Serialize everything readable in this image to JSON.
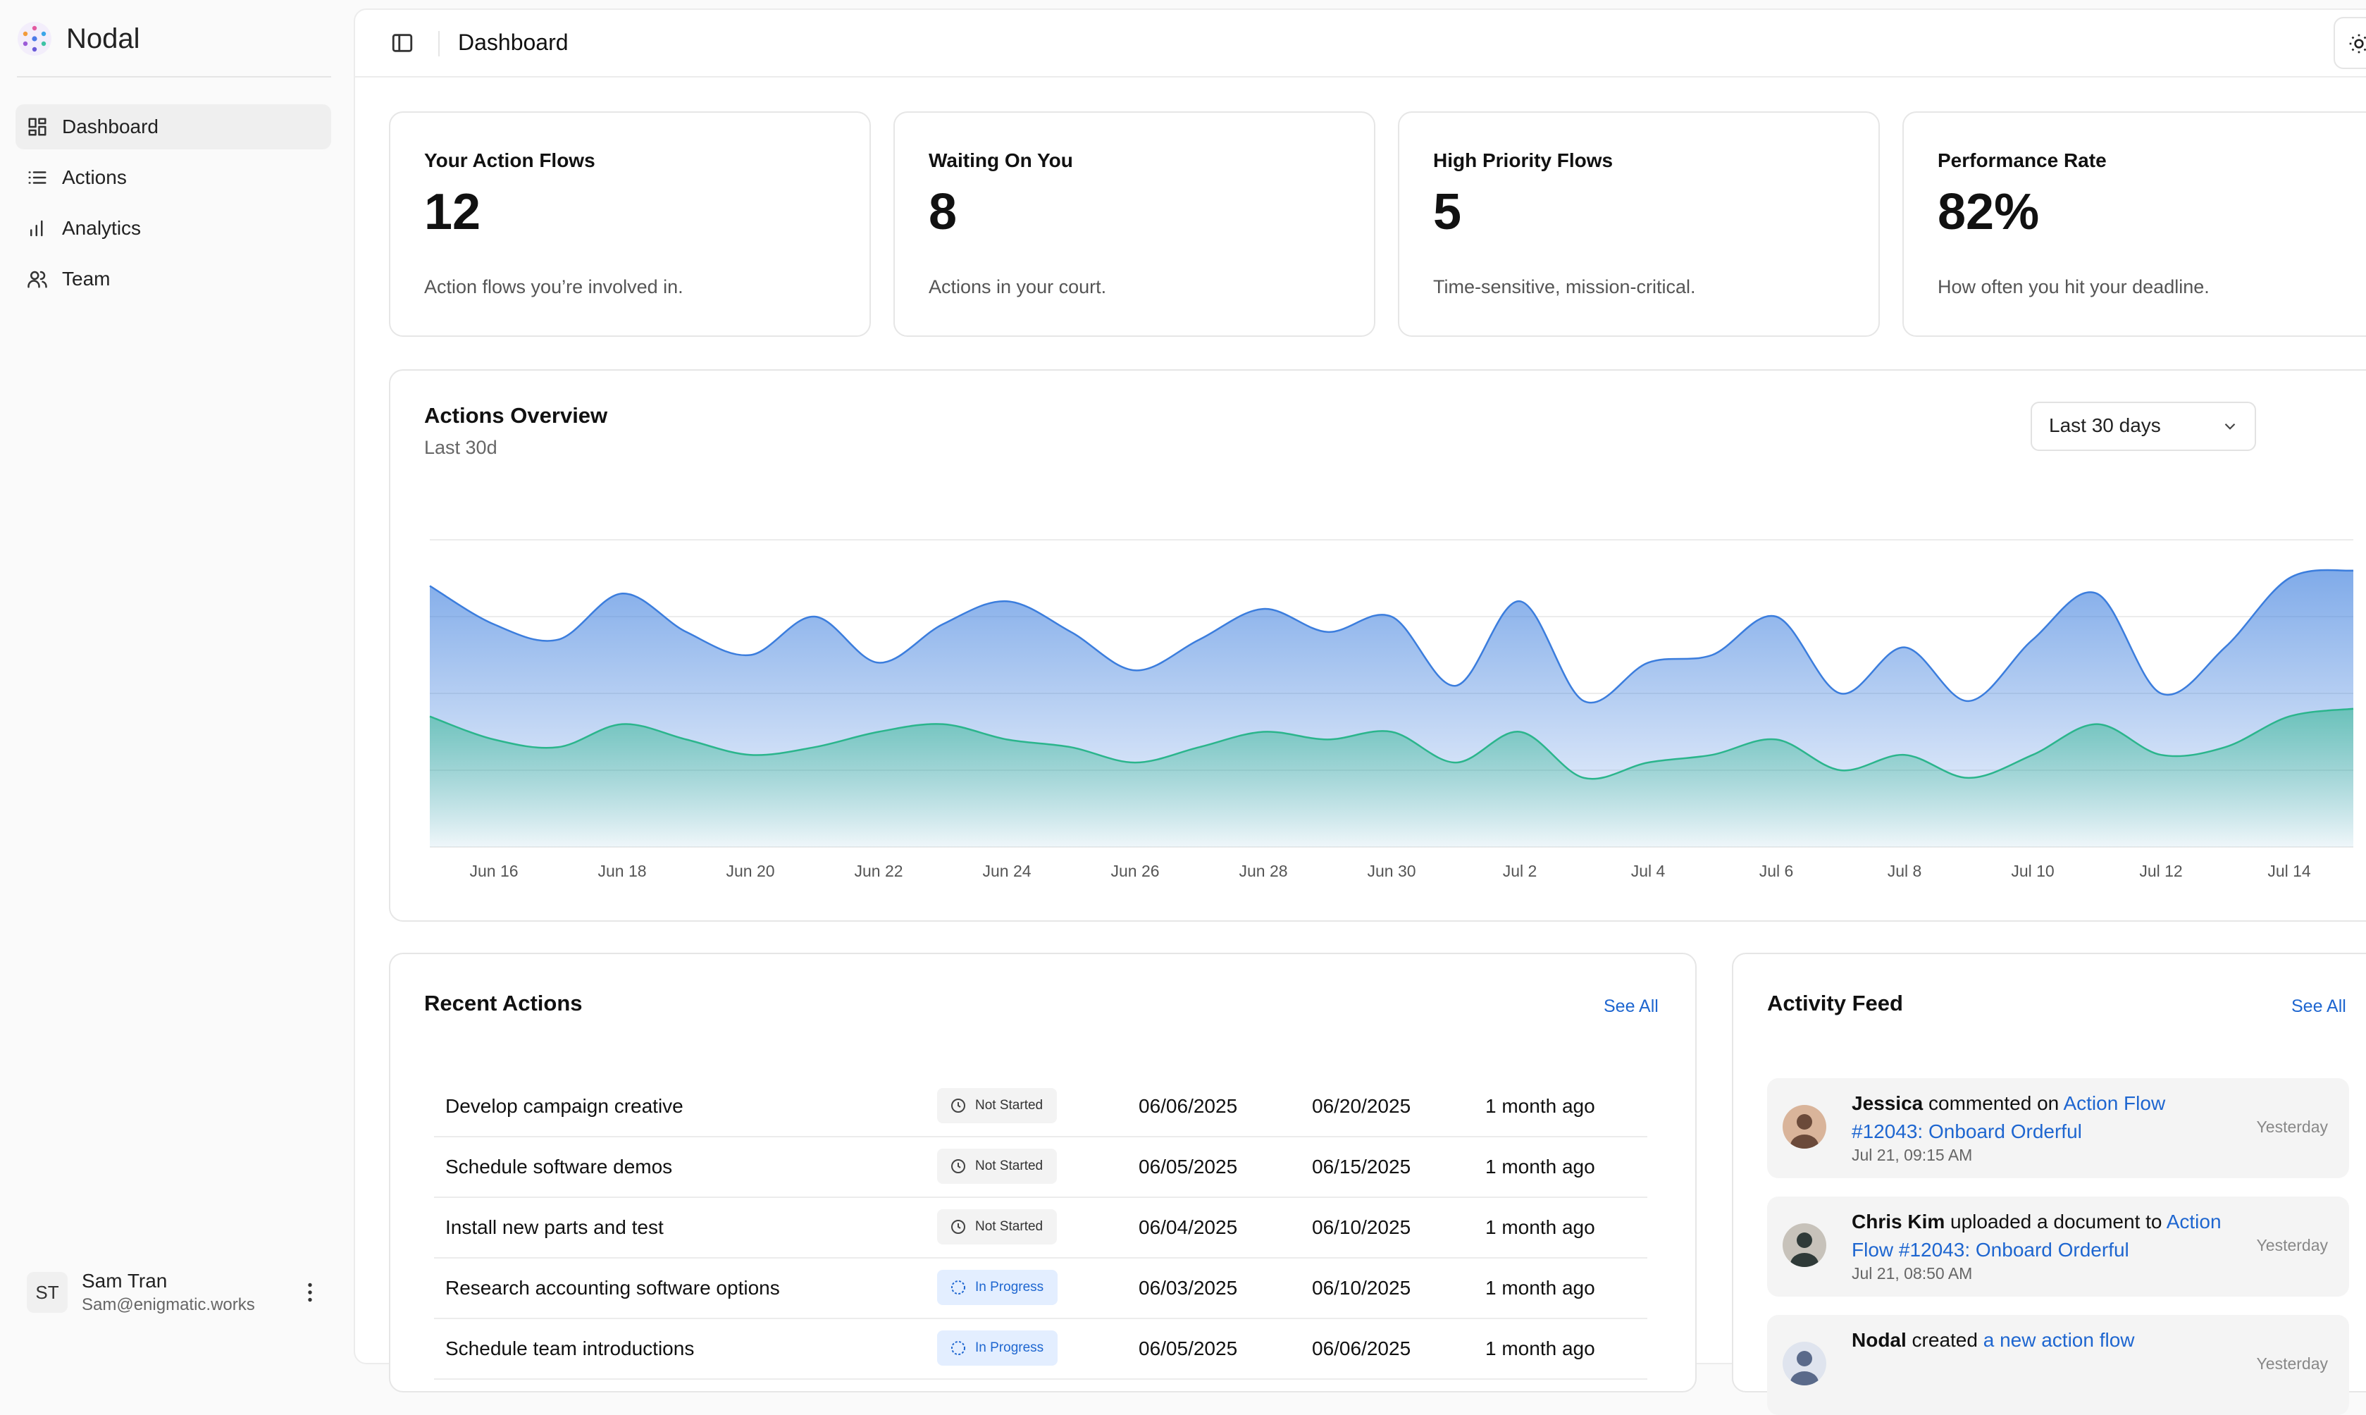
{
  "brand": {
    "name": "Nodal"
  },
  "sidebar": {
    "items": [
      {
        "label": "Dashboard",
        "icon": "dashboard-icon",
        "active": true
      },
      {
        "label": "Actions",
        "icon": "list-icon",
        "active": false
      },
      {
        "label": "Analytics",
        "icon": "bar-chart-icon",
        "active": false
      },
      {
        "label": "Team",
        "icon": "users-icon",
        "active": false
      }
    ],
    "user": {
      "initials": "ST",
      "name": "Sam Tran",
      "email": "Sam@enigmatic.works"
    }
  },
  "header": {
    "title": "Dashboard"
  },
  "stats": [
    {
      "title": "Your Action Flows",
      "value": "12",
      "desc": "Action flows you’re involved in."
    },
    {
      "title": "Waiting On You",
      "value": "8",
      "desc": "Actions in your court."
    },
    {
      "title": "High Priority Flows",
      "value": "5",
      "desc": "Time-sensitive, mission-critical."
    },
    {
      "title": "Performance Rate",
      "value": "82%",
      "desc": "How often you hit your deadline."
    }
  ],
  "overview": {
    "title": "Actions Overview",
    "subtitle": "Last 30d",
    "range": "Last 30 days"
  },
  "chart_data": {
    "type": "area",
    "title": "Actions Overview",
    "x": [
      "Jun 15",
      "Jun 16",
      "Jun 17",
      "Jun 18",
      "Jun 19",
      "Jun 20",
      "Jun 21",
      "Jun 22",
      "Jun 23",
      "Jun 24",
      "Jun 25",
      "Jun 26",
      "Jun 27",
      "Jun 28",
      "Jun 29",
      "Jun 30",
      "Jul 1",
      "Jul 2",
      "Jul 3",
      "Jul 4",
      "Jul 5",
      "Jul 6",
      "Jul 7",
      "Jul 8",
      "Jul 9",
      "Jul 10",
      "Jul 11",
      "Jul 12",
      "Jul 13",
      "Jul 14",
      "Jul 15"
    ],
    "xticks": [
      "Jun 16",
      "Jun 18",
      "Jun 20",
      "Jun 22",
      "Jun 24",
      "Jun 26",
      "Jun 28",
      "Jun 30",
      "Jul 2",
      "Jul 4",
      "Jul 6",
      "Jul 8",
      "Jul 10",
      "Jul 12",
      "Jul 14"
    ],
    "series": [
      {
        "values": [
          34,
          29,
          27,
          33,
          28,
          25,
          30,
          24,
          29,
          32,
          28,
          23,
          27,
          31,
          28,
          30,
          21,
          32,
          19,
          24,
          25,
          30,
          20,
          26,
          19,
          27,
          33,
          20,
          26,
          35,
          36
        ],
        "color": "#3b7ddd"
      },
      {
        "values": [
          17,
          14,
          13,
          16,
          14,
          12,
          13,
          15,
          16,
          14,
          13,
          11,
          13,
          15,
          14,
          15,
          11,
          15,
          9,
          11,
          12,
          14,
          10,
          12,
          9,
          12,
          16,
          12,
          13,
          17,
          18
        ],
        "color": "#2bb58c"
      }
    ],
    "ylim": [
      0,
      40
    ],
    "grid": true
  },
  "recent": {
    "title": "Recent Actions",
    "see_all": "See All",
    "rows": [
      {
        "name": "Develop campaign creative",
        "status": "Not Started",
        "status_type": "ns",
        "start": "06/06/2025",
        "due": "06/20/2025",
        "ago": "1 month ago"
      },
      {
        "name": "Schedule software demos",
        "status": "Not Started",
        "status_type": "ns",
        "start": "06/05/2025",
        "due": "06/15/2025",
        "ago": "1 month ago"
      },
      {
        "name": "Install new parts and test",
        "status": "Not Started",
        "status_type": "ns",
        "start": "06/04/2025",
        "due": "06/10/2025",
        "ago": "1 month ago"
      },
      {
        "name": "Research accounting software options",
        "status": "In Progress",
        "status_type": "ip",
        "start": "06/03/2025",
        "due": "06/10/2025",
        "ago": "1 month ago"
      },
      {
        "name": "Schedule team introductions",
        "status": "In Progress",
        "status_type": "ip",
        "start": "06/05/2025",
        "due": "06/06/2025",
        "ago": "1 month ago"
      }
    ]
  },
  "feed": {
    "title": "Activity Feed",
    "see_all": "See All",
    "items": [
      {
        "actor": "Jessica",
        "verb": " commented on ",
        "target": "Action Flow #12043: Onboard Orderful",
        "time": "Jul 21, 09:15 AM",
        "when": "Yesterday"
      },
      {
        "actor": "Chris Kim",
        "verb": " uploaded a document to ",
        "target": "Action Flow #12043: Onboard Orderful",
        "time": "Jul 21, 08:50 AM",
        "when": "Yesterday"
      },
      {
        "actor": "Nodal",
        "verb": " created ",
        "target": "a new action flow",
        "time": "",
        "when": "Yesterday"
      }
    ]
  }
}
